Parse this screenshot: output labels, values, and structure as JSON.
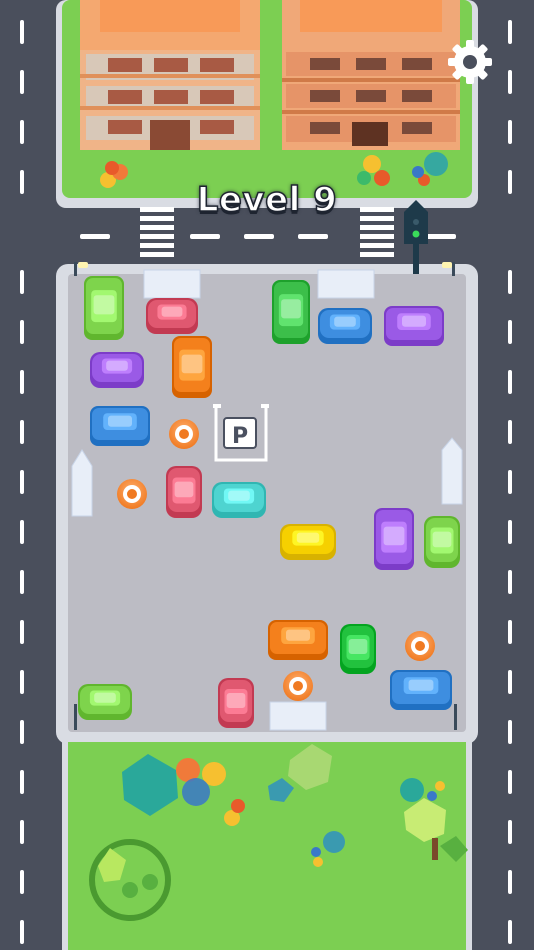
{
  "hud": {
    "level_label": "Level 9",
    "settings_icon": "gear-icon"
  },
  "lot": {
    "parking_sign": "P"
  },
  "colors": {
    "road": "#4a4f5c",
    "lot": "#bcbcc4",
    "grass": "#7ccf52",
    "building": "#f4a870"
  },
  "vehicles": [
    {
      "kind": "bus",
      "color": "#7ed44c",
      "name": "green-bus-top-left"
    },
    {
      "kind": "car",
      "color": "#e05870",
      "name": "pink-car-top"
    },
    {
      "kind": "bus",
      "color": "#3cbf4a",
      "name": "green-bus-top-center"
    },
    {
      "kind": "car",
      "color": "#3e8ee0",
      "name": "blue-car-top"
    },
    {
      "kind": "bus",
      "color": "#9a5ae6",
      "name": "purple-bus-top-right"
    },
    {
      "kind": "car",
      "color": "#9a5ae6",
      "name": "purple-car-left"
    },
    {
      "kind": "bus",
      "color": "#f4801c",
      "name": "orange-bus-left"
    },
    {
      "kind": "bus",
      "color": "#3e8ee0",
      "name": "blue-bus-left"
    },
    {
      "kind": "car",
      "color": "#e05870",
      "name": "pink-car-middle"
    },
    {
      "kind": "car",
      "color": "#4ed4d0",
      "name": "cyan-car-middle"
    },
    {
      "kind": "car",
      "color": "#f6d000",
      "name": "yellow-taxi"
    },
    {
      "kind": "bus",
      "color": "#9a5ae6",
      "name": "purple-bus-right"
    },
    {
      "kind": "car",
      "color": "#7ed44c",
      "name": "green-car-right"
    },
    {
      "kind": "bus",
      "color": "#f4801c",
      "name": "orange-bus-bottom"
    },
    {
      "kind": "car",
      "color": "#22c23e",
      "name": "green-car-bottom"
    },
    {
      "kind": "bus",
      "color": "#3e8ee0",
      "name": "blue-bus-bottom-right"
    },
    {
      "kind": "car",
      "color": "#7ed44c",
      "name": "green-car-bottom-left"
    },
    {
      "kind": "car",
      "color": "#e05870",
      "name": "pink-car-bottom"
    }
  ]
}
